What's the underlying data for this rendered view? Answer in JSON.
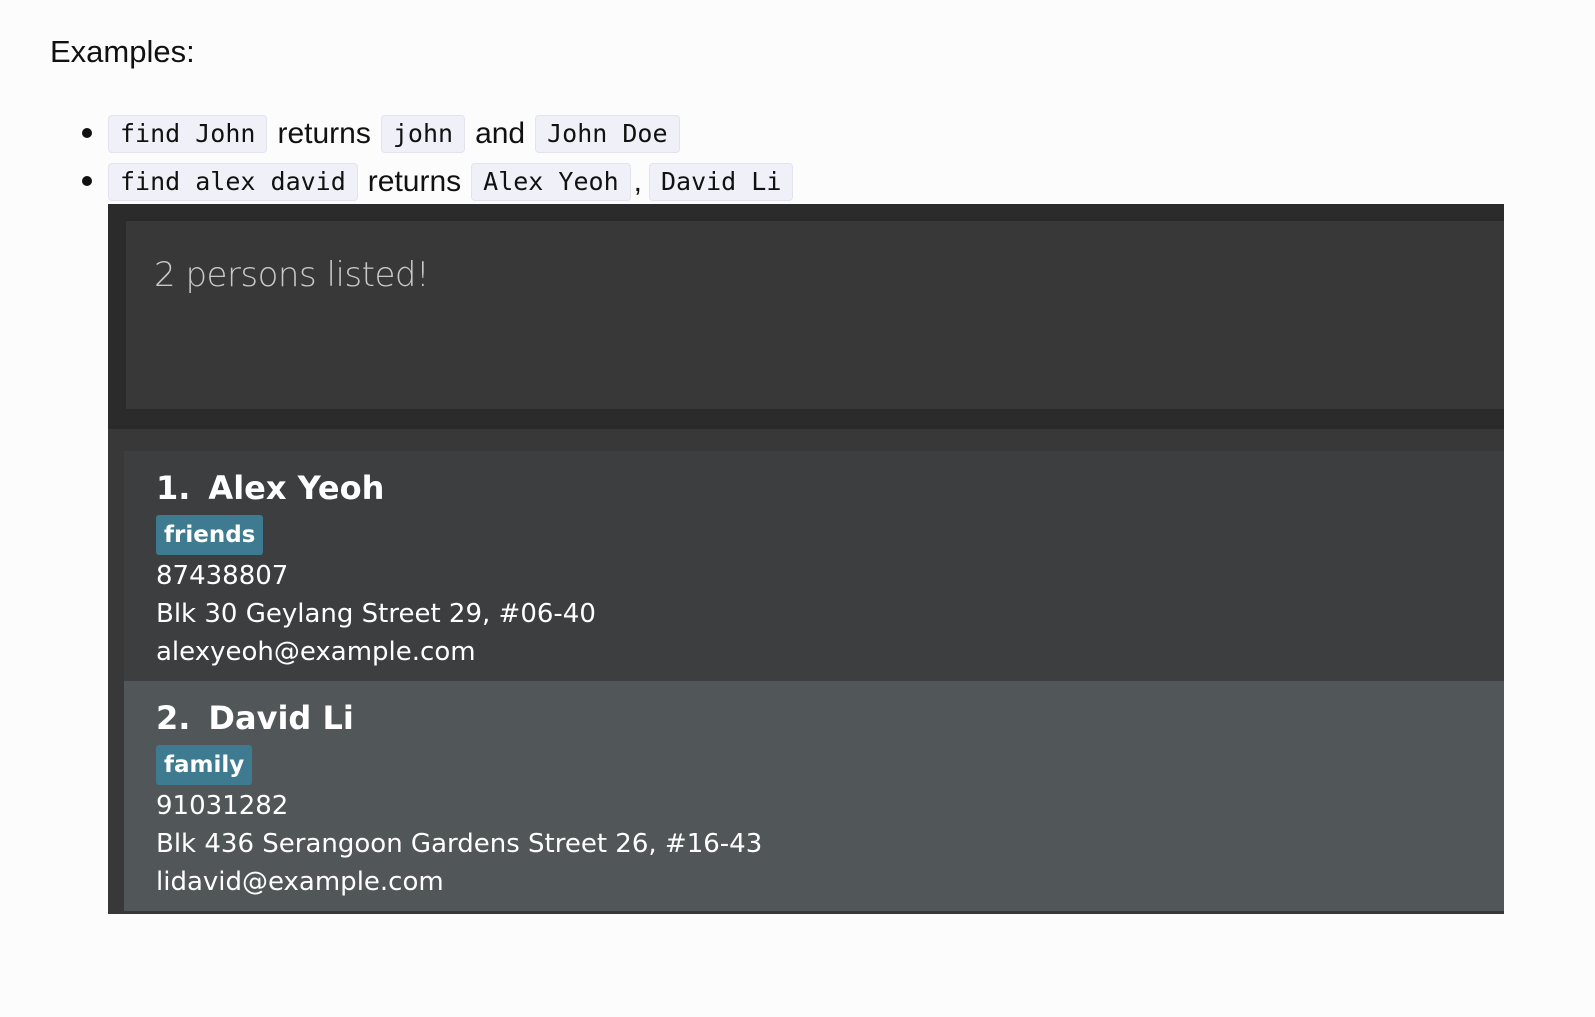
{
  "heading": "Examples:",
  "examples": [
    {
      "parts": [
        {
          "type": "code",
          "text": "find John"
        },
        {
          "type": "word",
          "text": "returns"
        },
        {
          "type": "code",
          "text": "john"
        },
        {
          "type": "word",
          "text": "and"
        },
        {
          "type": "code",
          "text": "John Doe"
        }
      ]
    },
    {
      "parts": [
        {
          "type": "code",
          "text": "find alex david"
        },
        {
          "type": "word",
          "text": "returns"
        },
        {
          "type": "code",
          "text": "Alex Yeoh"
        },
        {
          "type": "comma",
          "text": ","
        },
        {
          "type": "code",
          "text": "David Li"
        }
      ]
    }
  ],
  "app": {
    "result_message": "2 persons listed!",
    "persons": [
      {
        "index": "1.",
        "name": "Alex Yeoh",
        "tag": "friends",
        "phone": "87438807",
        "address": "Blk 30 Geylang Street 29, #06-40",
        "email": "alexyeoh@example.com"
      },
      {
        "index": "2.",
        "name": "David Li",
        "tag": "family",
        "phone": "91031282",
        "address": "Blk 436 Serangoon Gardens Street 26, #16-43",
        "email": "lidavid@example.com"
      }
    ],
    "colors": {
      "tag_background": "#3e7b91",
      "card_default": "#3c3e3f",
      "card_selected": "#515658"
    }
  }
}
